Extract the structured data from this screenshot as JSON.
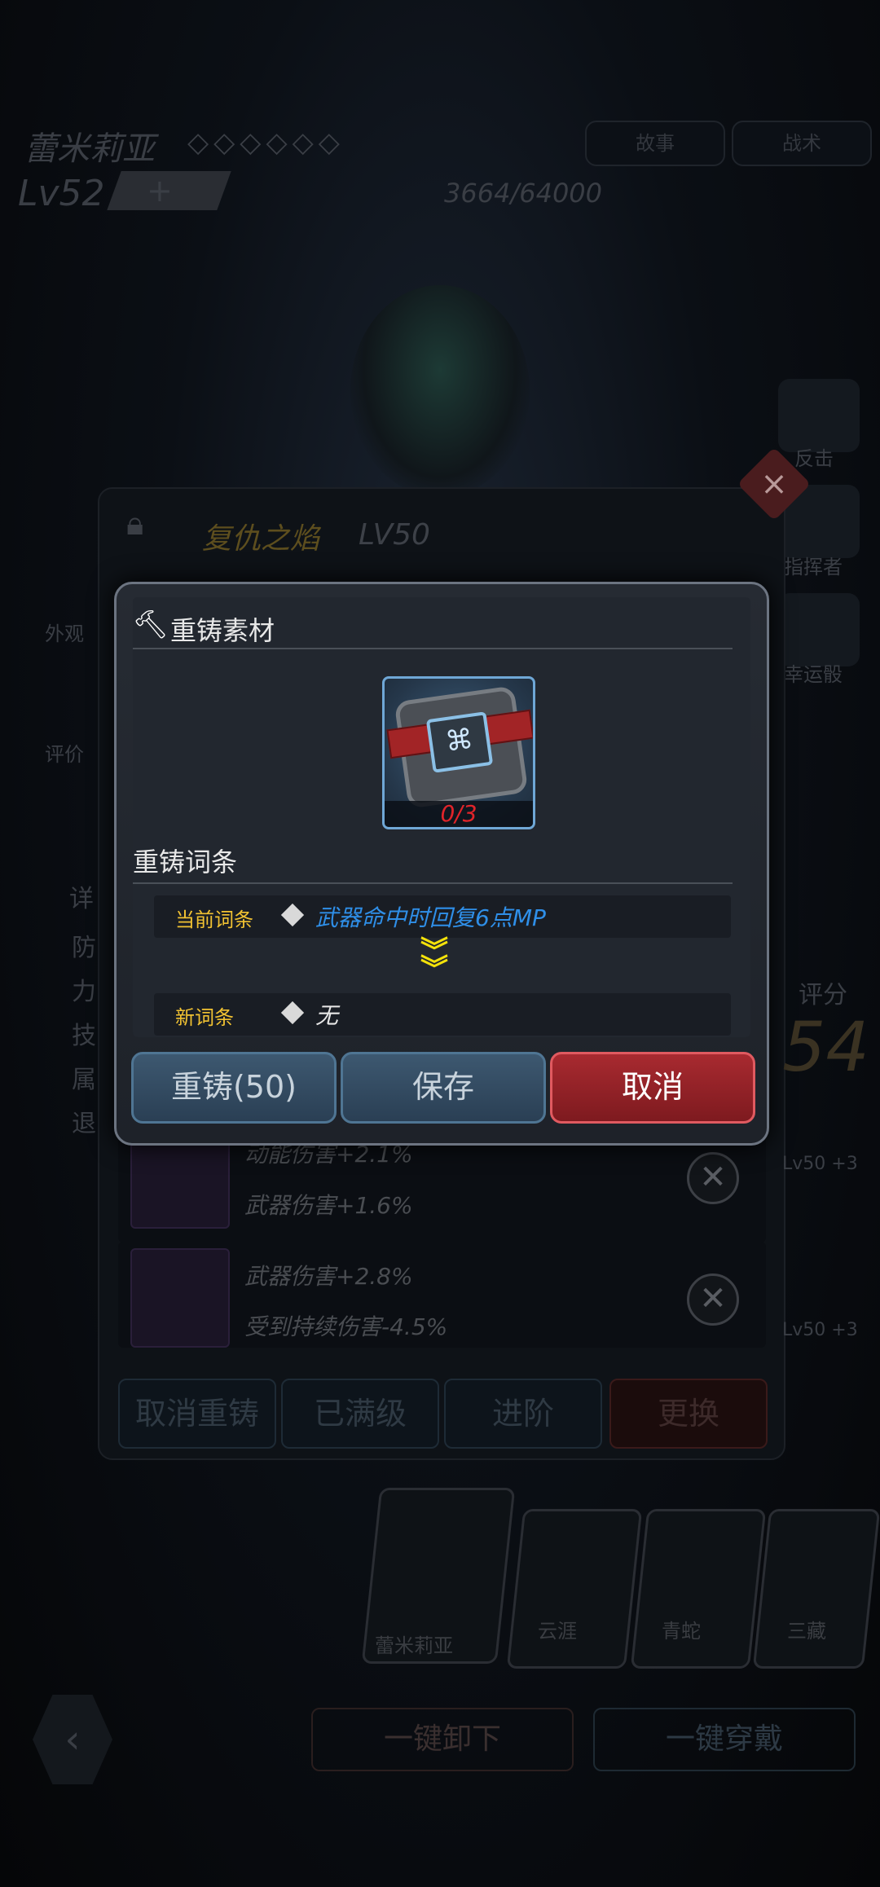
{
  "background": {
    "hero_name": "蕾米莉亚",
    "level": "Lv52",
    "plus": "+",
    "exp": "3664/64000",
    "tabs": [
      "故事",
      "战术"
    ],
    "right_icons": [
      "反击",
      "指挥者",
      "幸运骰"
    ],
    "left_icons": [
      "外观",
      "评价",
      "详",
      "防",
      "力",
      "技",
      "属",
      "退"
    ],
    "weapon_name": "复仇之焰",
    "weapon_level": "LV50",
    "score_label": "评分",
    "score_value": "54",
    "attr_rows": [
      {
        "line1": "动能伤害+2.1%",
        "line2": "武器伤害+1.6%"
      },
      {
        "line1": "武器伤害+2.8%",
        "line2": "受到持续伤害-4.5%"
      }
    ],
    "side_badges": [
      "Lv50 +3",
      "Lv50 +3"
    ],
    "bottom_buttons": [
      "取消重铸",
      "已满级",
      "进阶",
      "更换"
    ],
    "characters": [
      "蕾米莉亚",
      "云涯",
      "青蛇",
      "三藏"
    ],
    "footer_buttons": [
      "一键卸下",
      "一键穿戴"
    ]
  },
  "dialog": {
    "material_title": "重铸素材",
    "material_count": "0/3",
    "entries_title": "重铸词条",
    "current_label": "当前词条",
    "current_value": "武器命中时回复6点MP",
    "new_label": "新词条",
    "new_value": "无",
    "buttons": {
      "reforge": "重铸(50)",
      "save": "保存",
      "cancel": "取消"
    }
  },
  "colors": {
    "accent_gold": "#f1c232",
    "entry_blue": "#2f8fe8",
    "cancel_red": "#a82a30",
    "count_red": "#e0242a",
    "chevron_yellow": "#f4e20a"
  }
}
